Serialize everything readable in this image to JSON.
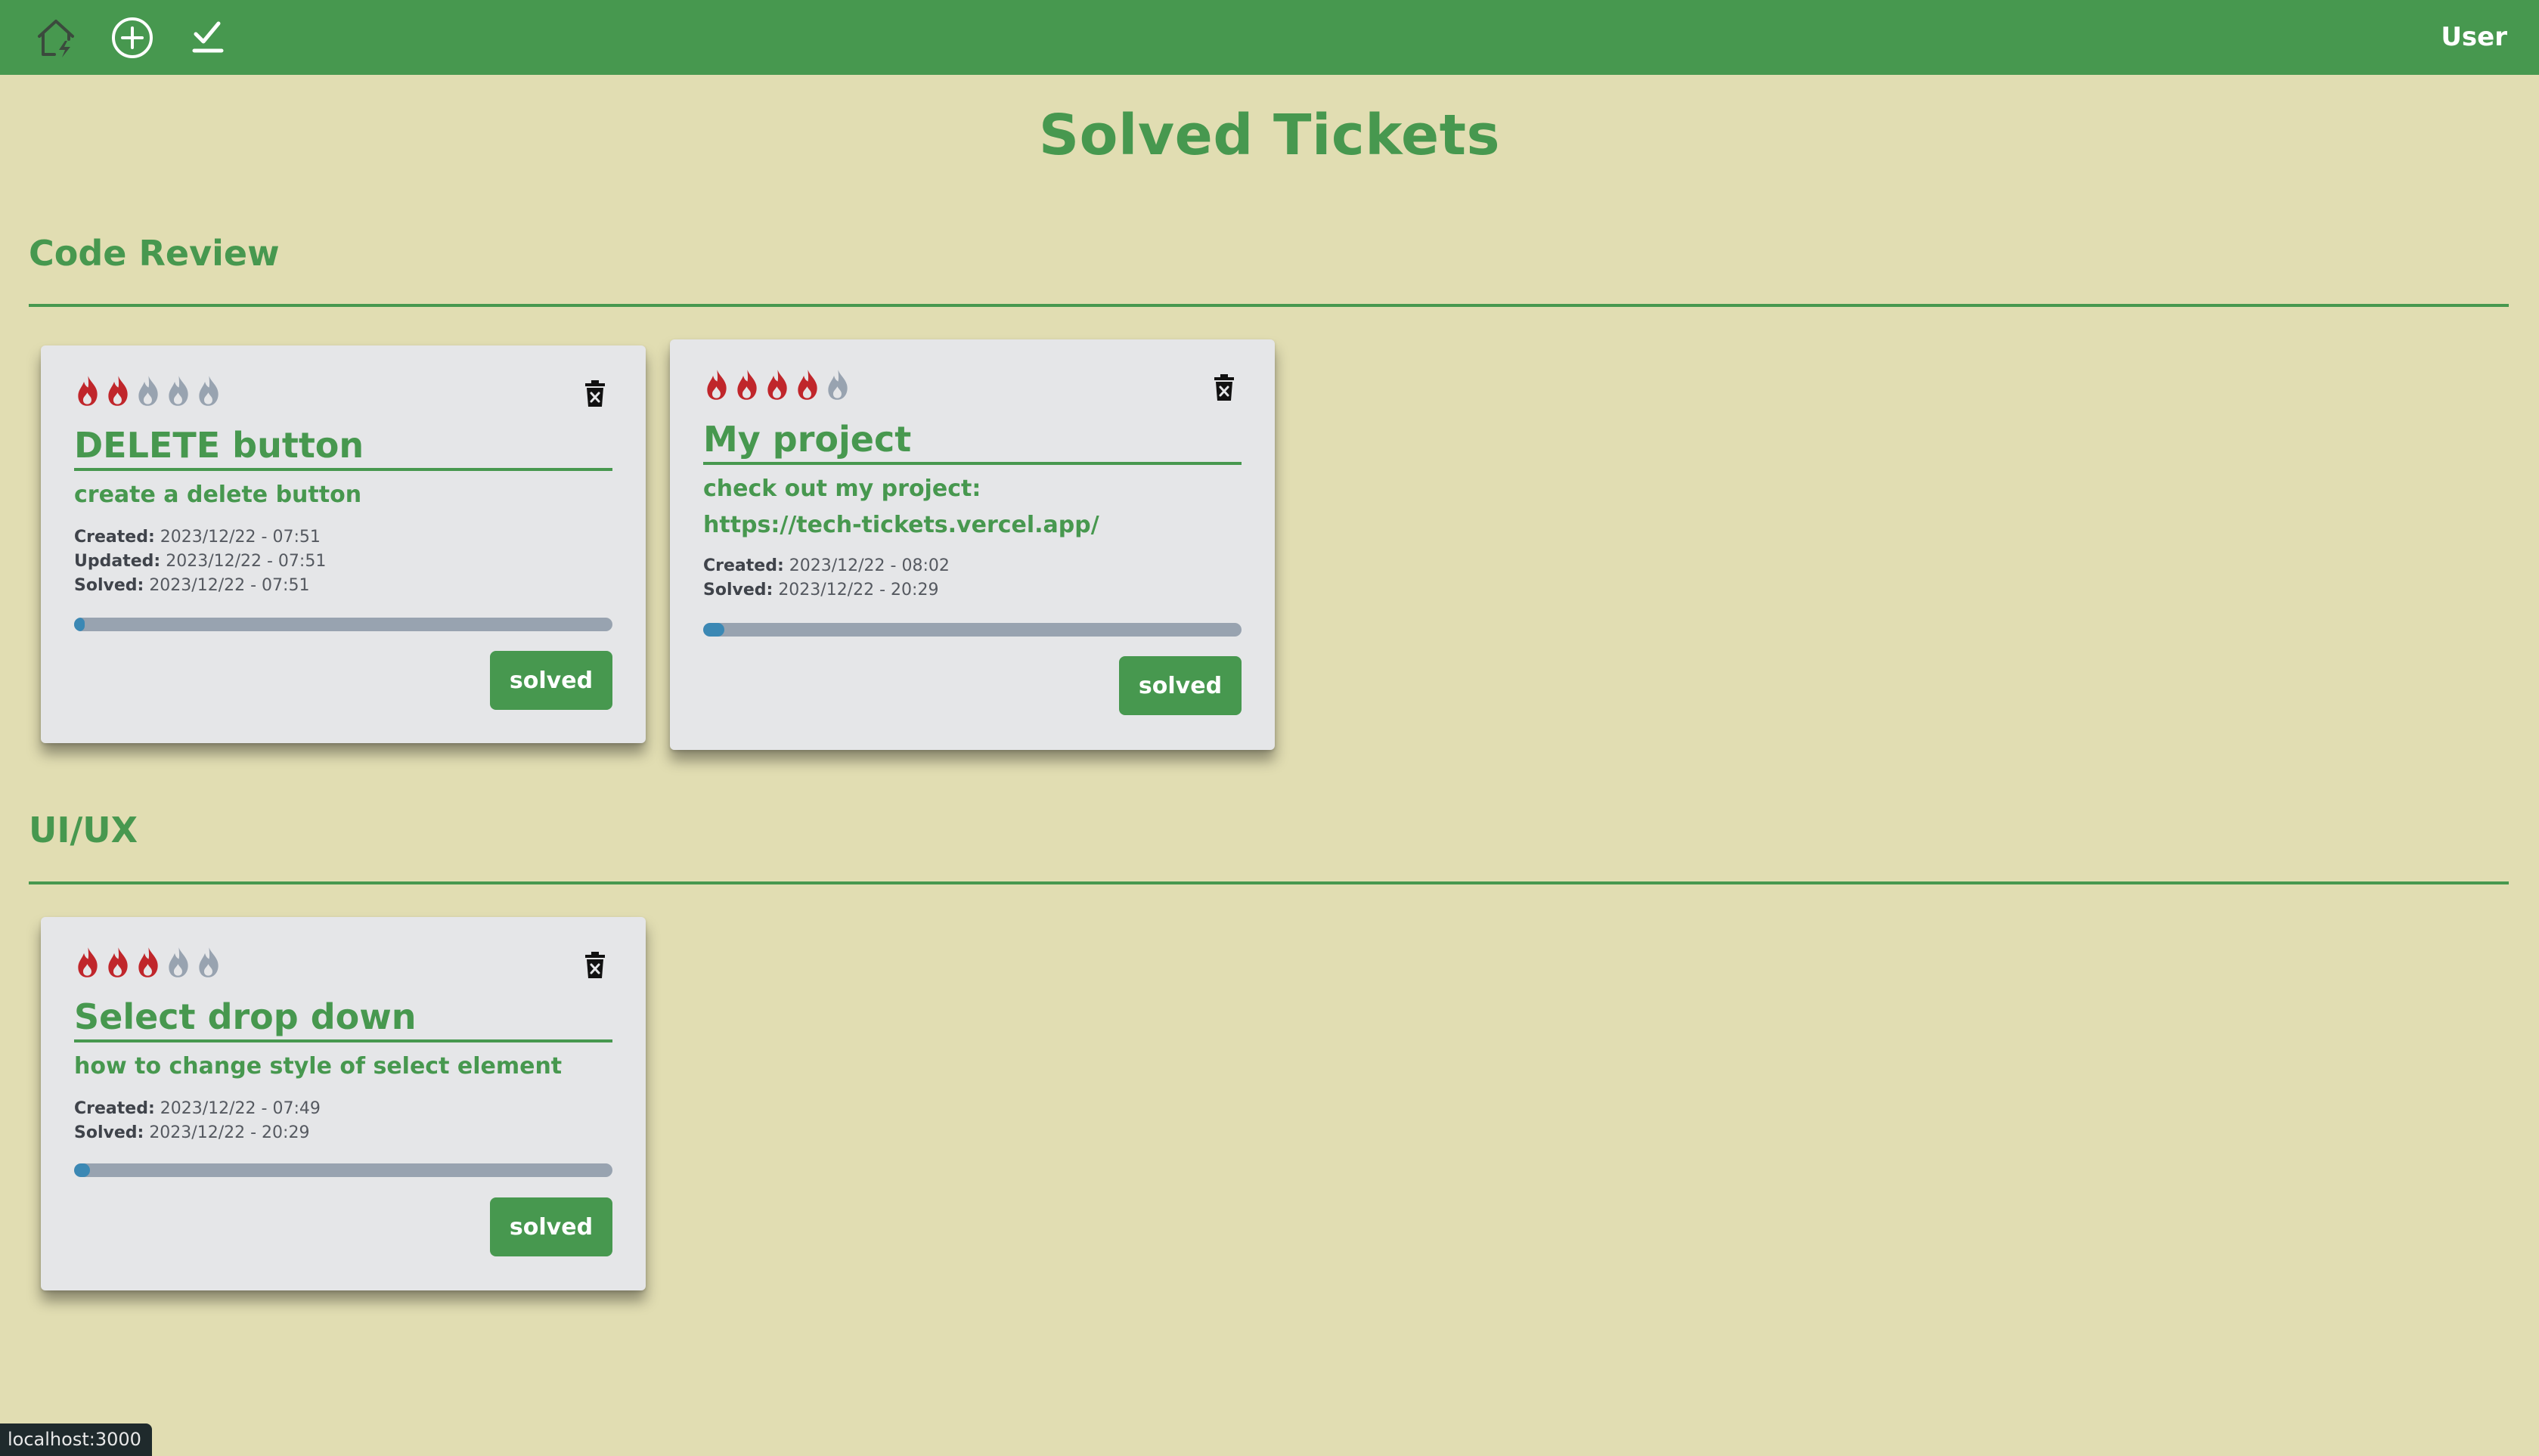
{
  "nav": {
    "icons": [
      "home-bolt-icon",
      "plus-circle-icon",
      "check-icon"
    ],
    "user_label": "User"
  },
  "page": {
    "title": "Solved Tickets"
  },
  "colors": {
    "brand_green": "#47984f",
    "background": "#e1ddb2",
    "card": "#e5e6e8",
    "flame_active": "#c0262b",
    "flame_inactive": "#98a3b0",
    "progress_track": "#98a3b0",
    "progress_fill": "#3b88b4"
  },
  "sections": [
    {
      "title": "Code Review",
      "tickets": [
        {
          "priority": 2,
          "priority_max": 5,
          "title": "DELETE button",
          "description": [
            "create a delete button"
          ],
          "meta": [
            {
              "label": "Created:",
              "value": "2023/12/22 - 07:51"
            },
            {
              "label": "Updated:",
              "value": "2023/12/22 - 07:51"
            },
            {
              "label": "Solved:",
              "value": "2023/12/22 - 07:51"
            }
          ],
          "progress": 0.02,
          "status_label": "solved"
        },
        {
          "priority": 4,
          "priority_max": 5,
          "title": "My project",
          "description": [
            "check out my project:",
            "https://tech-tickets.vercel.app/"
          ],
          "meta": [
            {
              "label": "Created:",
              "value": "2023/12/22 - 08:02"
            },
            {
              "label": "Solved:",
              "value": "2023/12/22 - 20:29"
            }
          ],
          "progress": 0.04,
          "status_label": "solved"
        }
      ]
    },
    {
      "title": "UI/UX",
      "tickets": [
        {
          "priority": 3,
          "priority_max": 5,
          "title": "Select drop down",
          "description": [
            "how to change style of select element"
          ],
          "meta": [
            {
              "label": "Created:",
              "value": "2023/12/22 - 07:49"
            },
            {
              "label": "Solved:",
              "value": "2023/12/22 - 20:29"
            }
          ],
          "progress": 0.03,
          "status_label": "solved"
        }
      ]
    }
  ],
  "status_bar": {
    "url": "localhost:3000"
  }
}
